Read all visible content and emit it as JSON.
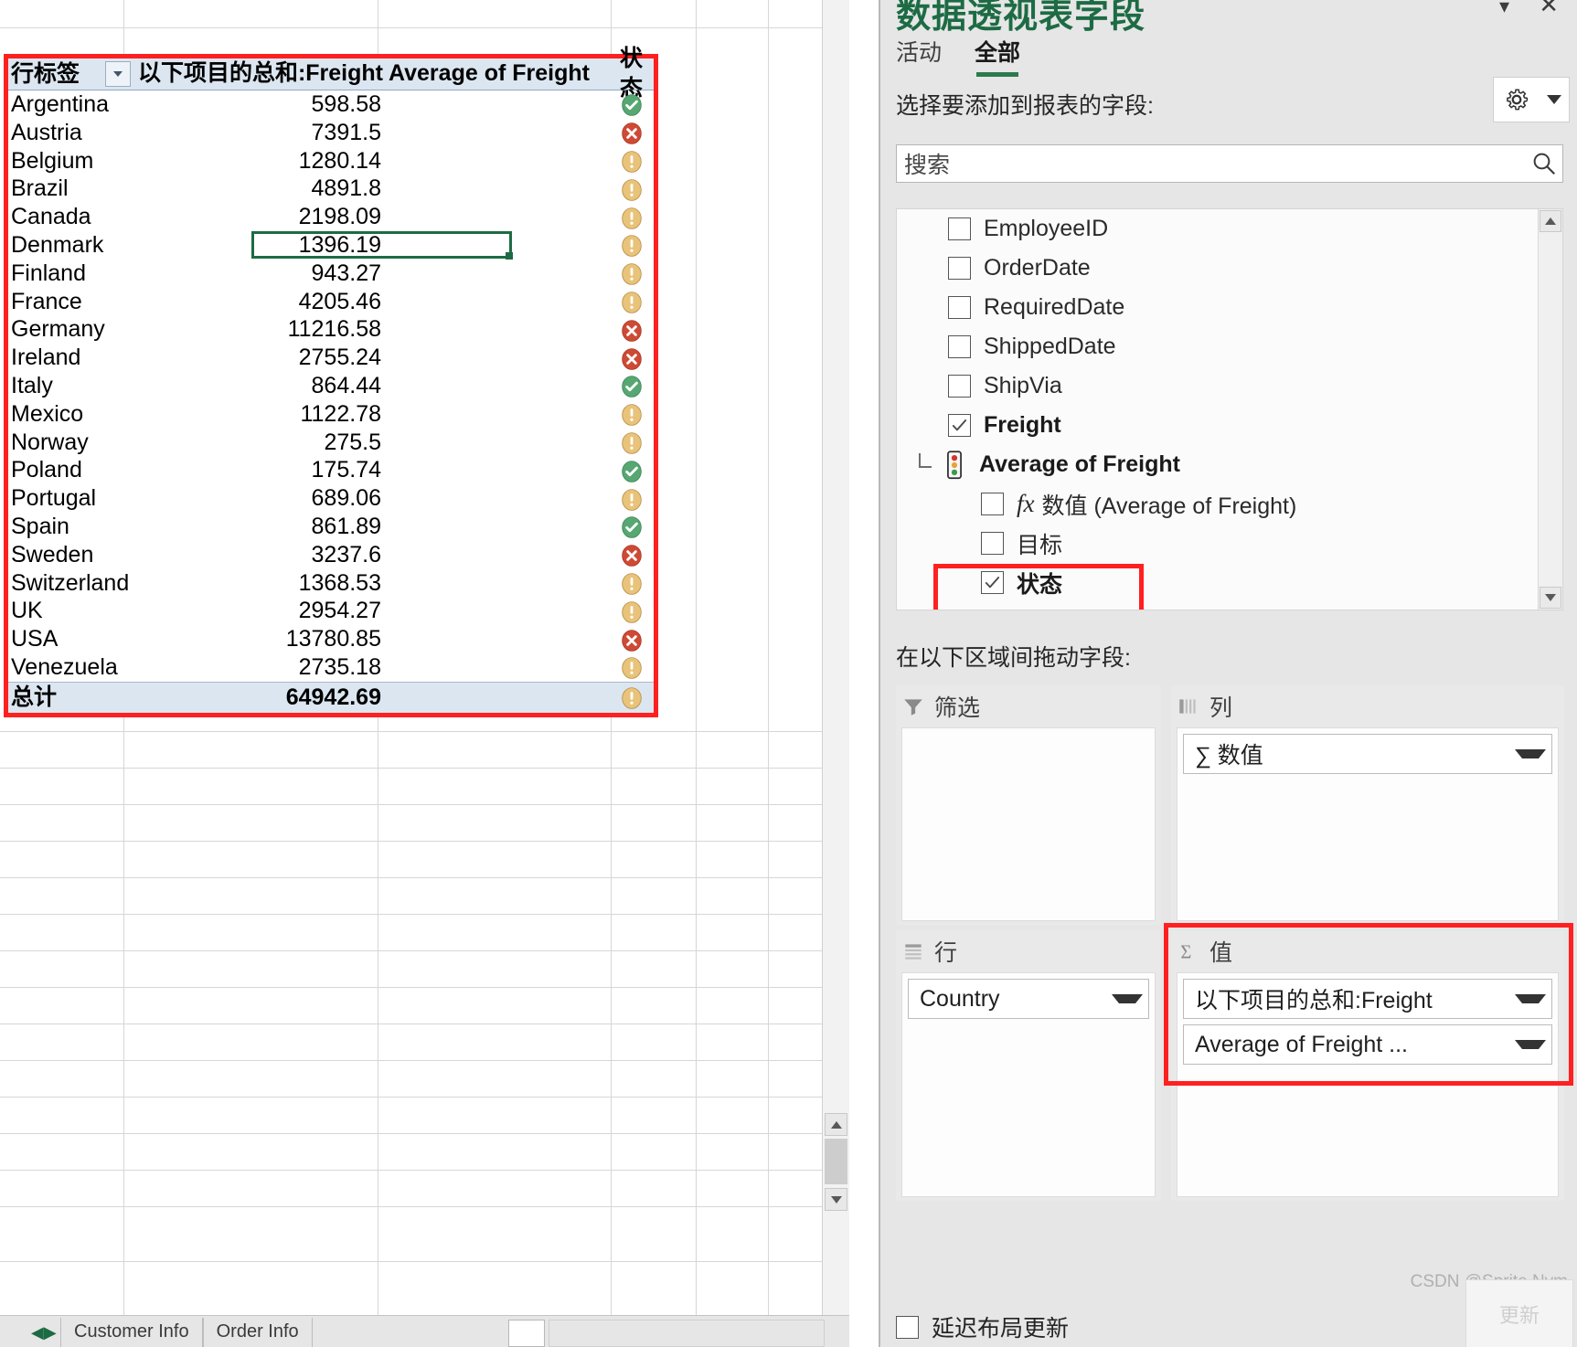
{
  "pivot_table": {
    "headers": {
      "row_labels": "行标签",
      "sum_freight": "以下项目的总和:Freight",
      "avg_freight": "Average of Freight",
      "status": "状态"
    },
    "rows": [
      {
        "country": "Argentina",
        "sum": "598.58",
        "status": "ok"
      },
      {
        "country": "Austria",
        "sum": "7391.5",
        "status": "bad"
      },
      {
        "country": "Belgium",
        "sum": "1280.14",
        "status": "warn"
      },
      {
        "country": "Brazil",
        "sum": "4891.8",
        "status": "warn"
      },
      {
        "country": "Canada",
        "sum": "2198.09",
        "status": "warn"
      },
      {
        "country": "Denmark",
        "sum": "1396.19",
        "status": "warn",
        "selected": true
      },
      {
        "country": "Finland",
        "sum": "943.27",
        "status": "warn"
      },
      {
        "country": "France",
        "sum": "4205.46",
        "status": "warn"
      },
      {
        "country": "Germany",
        "sum": "11216.58",
        "status": "bad"
      },
      {
        "country": "Ireland",
        "sum": "2755.24",
        "status": "bad"
      },
      {
        "country": "Italy",
        "sum": "864.44",
        "status": "ok"
      },
      {
        "country": "Mexico",
        "sum": "1122.78",
        "status": "warn"
      },
      {
        "country": "Norway",
        "sum": "275.5",
        "status": "warn"
      },
      {
        "country": "Poland",
        "sum": "175.74",
        "status": "ok"
      },
      {
        "country": "Portugal",
        "sum": "689.06",
        "status": "warn"
      },
      {
        "country": "Spain",
        "sum": "861.89",
        "status": "ok"
      },
      {
        "country": "Sweden",
        "sum": "3237.6",
        "status": "bad"
      },
      {
        "country": "Switzerland",
        "sum": "1368.53",
        "status": "warn"
      },
      {
        "country": "UK",
        "sum": "2954.27",
        "status": "warn"
      },
      {
        "country": "USA",
        "sum": "13780.85",
        "status": "bad"
      },
      {
        "country": "Venezuela",
        "sum": "2735.18",
        "status": "warn"
      }
    ],
    "total": {
      "label": "总计",
      "sum": "64942.69",
      "status": "warn"
    }
  },
  "tabstrip": {
    "tabs": [
      "Customer Info",
      "Order Info"
    ]
  },
  "pane": {
    "title": "数据透视表字段",
    "tabs": [
      {
        "label": "活动",
        "active": false
      },
      {
        "label": "全部",
        "active": true
      }
    ],
    "choose_fields_label": "选择要添加到报表的字段:",
    "gear_icon": "gear-icon",
    "search": {
      "placeholder": "搜索",
      "value": "搜索",
      "icon": "search-icon"
    },
    "fields": [
      {
        "label": "EmployeeID",
        "checked": false,
        "bold": false,
        "level": 1
      },
      {
        "label": "OrderDate",
        "checked": false,
        "bold": false,
        "level": 1
      },
      {
        "label": "RequiredDate",
        "checked": false,
        "bold": false,
        "level": 1
      },
      {
        "label": "ShippedDate",
        "checked": false,
        "bold": false,
        "level": 1
      },
      {
        "label": "ShipVia",
        "checked": false,
        "bold": false,
        "level": 1
      },
      {
        "label": "Freight",
        "checked": true,
        "bold": true,
        "level": 1
      },
      {
        "label": "Average of Freight",
        "group": true,
        "bold": true,
        "icon": "traffic-light-icon"
      },
      {
        "label": "数值 (Average of Freight)",
        "checked": false,
        "bold": false,
        "level": 2,
        "fx": true
      },
      {
        "label": "目标",
        "checked": false,
        "bold": false,
        "level": 2
      },
      {
        "label": "状态",
        "checked": true,
        "bold": true,
        "level": 2,
        "highlighted": true
      }
    ],
    "drag_label": "在以下区域间拖动字段:",
    "zones": [
      {
        "id": "filter",
        "title": "筛选",
        "icon": "filter-icon",
        "chips": []
      },
      {
        "id": "columns",
        "title": "列",
        "icon": "columns-icon",
        "chips": [
          {
            "label": "∑ 数值"
          }
        ]
      },
      {
        "id": "rows",
        "title": "行",
        "icon": "rows-icon",
        "chips": [
          {
            "label": "Country"
          }
        ]
      },
      {
        "id": "values",
        "title": "值",
        "icon": "sigma-icon",
        "highlighted": true,
        "chips": [
          {
            "label": "以下项目的总和:Freight"
          },
          {
            "label": "Average of Freight ..."
          }
        ]
      }
    ],
    "defer": {
      "label": "延迟布局更新",
      "checked": false
    }
  },
  "watermark": {
    "text": "CSDN @Sprite.Nym",
    "box_text": "更新"
  }
}
